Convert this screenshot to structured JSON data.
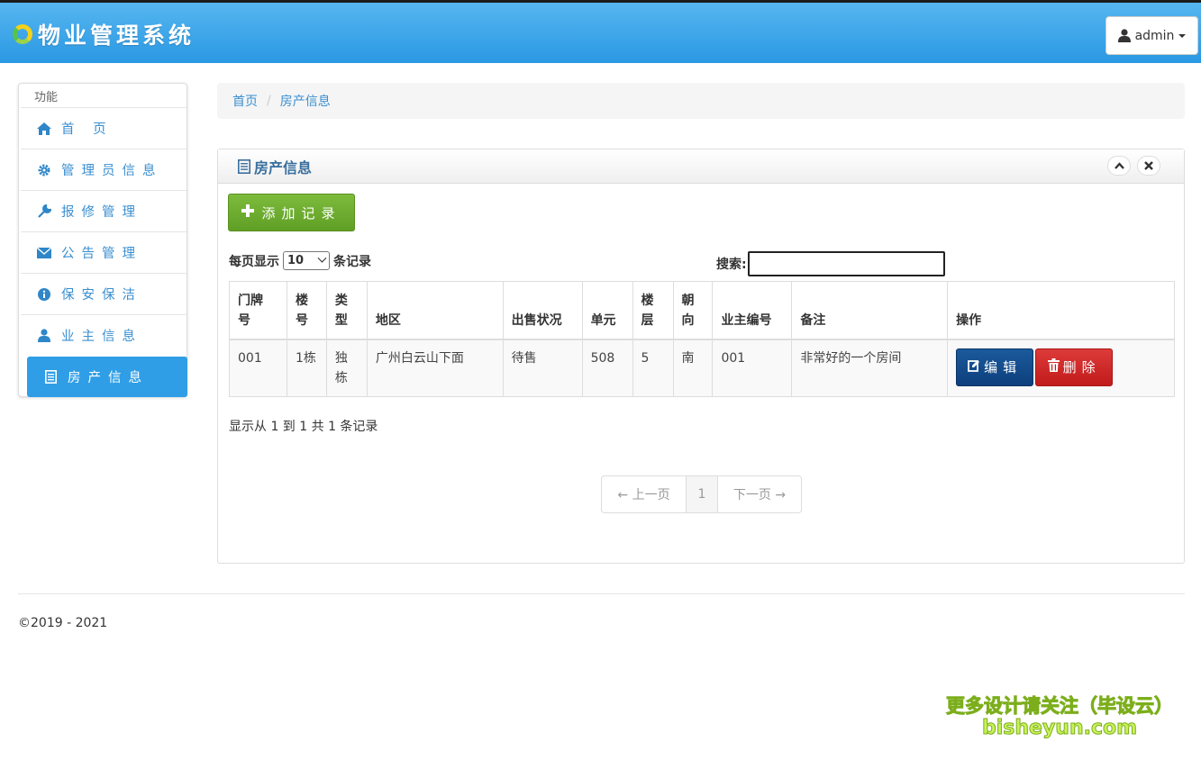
{
  "app": {
    "title": "物业管理系统",
    "user_label": "admin"
  },
  "sidebar": {
    "heading": "功能",
    "items": [
      {
        "label": "首 页",
        "icon": "home-icon"
      },
      {
        "label": "管理员信息",
        "icon": "gear-icon"
      },
      {
        "label": "报修管理",
        "icon": "wrench-icon"
      },
      {
        "label": "公告管理",
        "icon": "envelope-icon"
      },
      {
        "label": "保安保洁",
        "icon": "info-icon"
      },
      {
        "label": "业主信息",
        "icon": "user-icon"
      },
      {
        "label": "房产信息",
        "icon": "list-icon",
        "active": true
      }
    ]
  },
  "breadcrumb": {
    "home": "首页",
    "separator": "/",
    "current": "房产信息"
  },
  "panel": {
    "title": "房产信息",
    "add_button": "添加记录",
    "length_prefix": "每页显示",
    "length_value": "10",
    "length_suffix": "条记录",
    "search_label": "搜索:",
    "search_value": ""
  },
  "table": {
    "headers": [
      "门牌号",
      "楼号",
      "类型",
      "地区",
      "出售状况",
      "单元",
      "楼层",
      "朝向",
      "业主编号",
      "备注",
      "操作"
    ],
    "header_lines": [
      [
        "门牌",
        "号"
      ],
      [
        "楼",
        "号"
      ],
      [
        "类",
        "型"
      ],
      [
        "地区"
      ],
      [
        "出售状况"
      ],
      [
        "单元"
      ],
      [
        "楼",
        "层"
      ],
      [
        "朝",
        "向"
      ],
      [
        "业主编号"
      ],
      [
        "备注"
      ],
      [
        "操作"
      ]
    ],
    "rows": [
      {
        "cells": [
          "001",
          "1栋",
          "独栋",
          "广州白云山下面",
          "待售",
          "508",
          "5",
          "南",
          "001",
          "非常好的一个房间"
        ],
        "edit_label": "编辑",
        "delete_label": "删除"
      }
    ]
  },
  "info_text": "显示从 1 到 1 共 1 条记录",
  "pager": {
    "prev": "← 上一页",
    "current": "1",
    "next": "下一页 →"
  },
  "footer": {
    "copyright": "©2019 - 2021"
  },
  "watermark": {
    "line1": "更多设计请关注（毕设云）",
    "line2": "bisheyun.com"
  },
  "colors": {
    "header_blue": "#2a98e3",
    "link_blue": "#3a8fd0",
    "add_green": "#6aab2e",
    "edit_navy": "#0d3f7c",
    "delete_red": "#c11b1b"
  }
}
